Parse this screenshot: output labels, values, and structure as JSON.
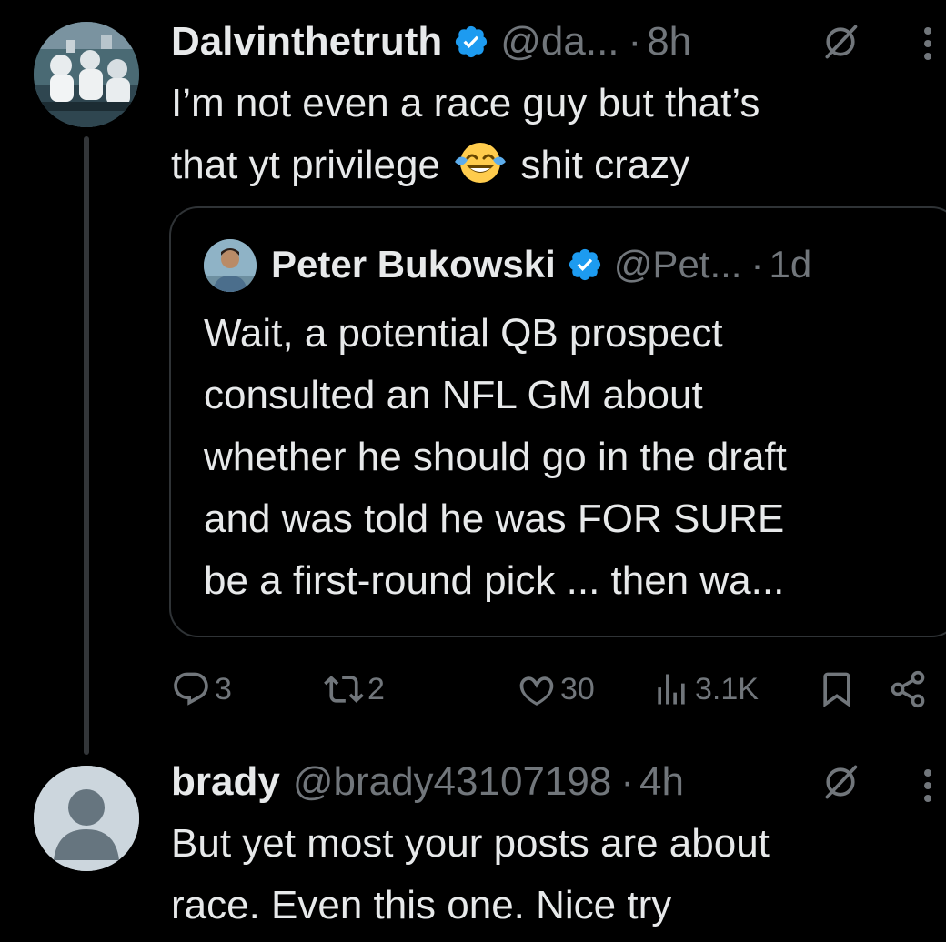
{
  "tweet1": {
    "display_name": "Dalvinthetruth",
    "handle": "@da...",
    "separator": "·",
    "time": "8h",
    "text_line1": "I’m not even a race guy but that’s",
    "text_before_emoji": "that yt privilege",
    "emoji": "face-with-tears-of-joy",
    "text_after_emoji": "shit crazy",
    "quote": {
      "display_name": "Peter Bukowski",
      "handle": "@Pet...",
      "separator": "·",
      "time": "1d",
      "lines": [
        "Wait, a potential QB prospect",
        "consulted an NFL GM about",
        "whether he should go in the draft",
        "and was told he was FOR SURE",
        "be a first-round pick ... then wa..."
      ]
    },
    "actions": {
      "replies": "3",
      "reposts": "2",
      "likes": "30",
      "views": "3.1K"
    }
  },
  "tweet2": {
    "display_name": "brady",
    "handle": "@brady43107198",
    "separator": "·",
    "time": "4h",
    "lines": [
      "But yet most your posts are about",
      "race. Even this one. Nice try"
    ]
  },
  "colors": {
    "background": "#000000",
    "text_primary": "#e7e9ea",
    "text_secondary": "#71767b",
    "verified_blue": "#1d9bf0",
    "border": "#2f3336"
  }
}
